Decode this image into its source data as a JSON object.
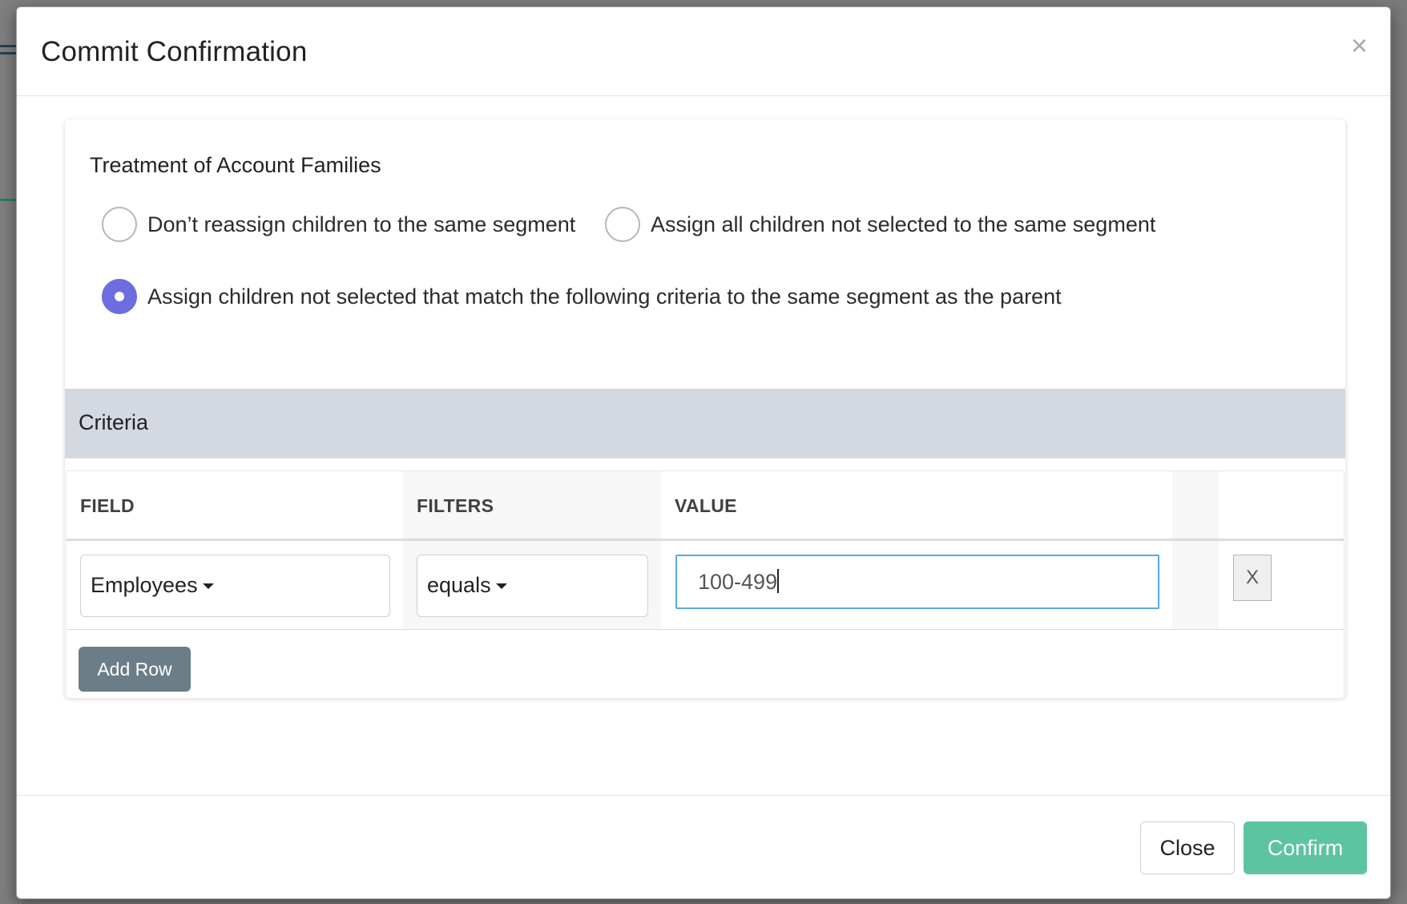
{
  "modal": {
    "title": "Commit Confirmation",
    "close_icon": "×"
  },
  "treatment": {
    "heading": "Treatment of Account Families",
    "options": [
      {
        "label": "Don’t reassign children to the same segment",
        "checked": false
      },
      {
        "label": "Assign all children not selected to the same segment",
        "checked": false
      },
      {
        "label": "Assign children not selected that match the following criteria to the same segment as the parent",
        "checked": true
      }
    ]
  },
  "criteria": {
    "title": "Criteria",
    "columns": {
      "field": "FIELD",
      "filters": "FILTERS",
      "value": "VALUE"
    },
    "rows": [
      {
        "field": "Employees",
        "filter": "equals",
        "value": "100-499",
        "remove_label": "X"
      }
    ],
    "add_row_label": "Add Row"
  },
  "footer": {
    "close_label": "Close",
    "confirm_label": "Confirm"
  },
  "colors": {
    "radio_checked": "#6d6de0",
    "confirm": "#5cc4a0",
    "add_row": "#6b7d87",
    "criteria_bar": "#d4d8e1",
    "input_focus": "#5aa9e6"
  }
}
